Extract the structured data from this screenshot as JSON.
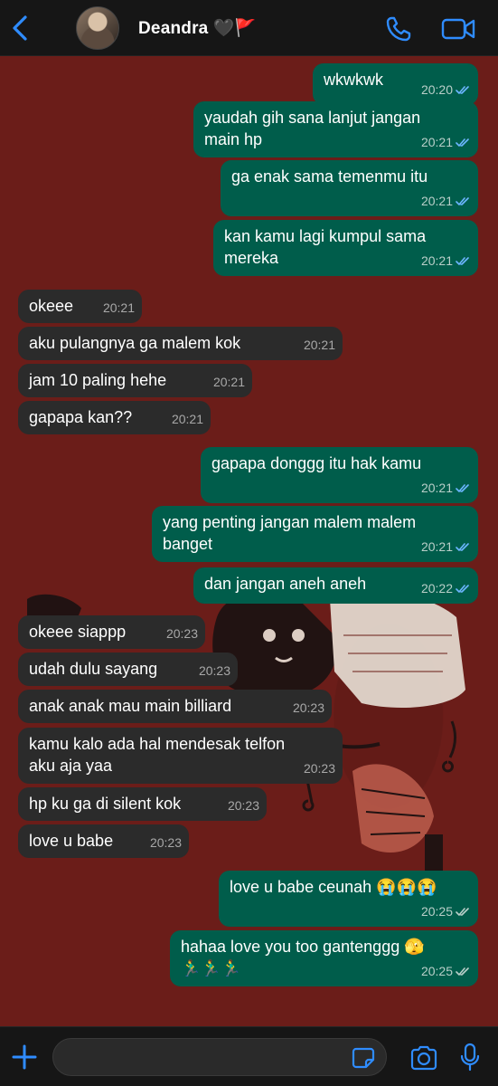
{
  "header": {
    "contact_name": "Deandra 🖤🚩",
    "back_icon": "chevron-left-icon",
    "call_icon": "phone-icon",
    "video_icon": "video-camera-icon"
  },
  "colors": {
    "outgoing_bubble": "#005d4b",
    "incoming_bubble": "#2b2b2b",
    "accent": "#2f8cff",
    "wallpaper": "#6b1d19"
  },
  "messages": [
    {
      "dir": "out",
      "text": "wkwkwk",
      "time": "20:20"
    },
    {
      "dir": "out",
      "text": "yaudah gih sana lanjut jangan\nmain hp",
      "time": "20:21"
    },
    {
      "dir": "out",
      "text": "ga enak sama temenmu itu",
      "time": "20:21"
    },
    {
      "dir": "out",
      "text": "kan kamu lagi kumpul sama\nmereka",
      "time": "20:21"
    },
    {
      "dir": "in",
      "text": "okeee",
      "time": "20:21"
    },
    {
      "dir": "in",
      "text": "aku pulangnya ga malem kok",
      "time": "20:21"
    },
    {
      "dir": "in",
      "text": "jam 10 paling hehe",
      "time": "20:21"
    },
    {
      "dir": "in",
      "text": "gapapa kan??",
      "time": "20:21"
    },
    {
      "dir": "out",
      "text": "gapapa donggg itu hak kamu",
      "time": "20:21"
    },
    {
      "dir": "out",
      "text": "yang penting jangan malem malem\nbanget",
      "time": "20:21"
    },
    {
      "dir": "out",
      "text": "dan jangan aneh aneh",
      "time": "20:22"
    },
    {
      "dir": "in",
      "text": "okeee siappp",
      "time": "20:23"
    },
    {
      "dir": "in",
      "text": "udah dulu sayang",
      "time": "20:23"
    },
    {
      "dir": "in",
      "text": "anak anak mau main billiard",
      "time": "20:23"
    },
    {
      "dir": "in",
      "text": "kamu kalo ada hal mendesak telfon\naku aja yaa",
      "time": "20:23"
    },
    {
      "dir": "in",
      "text": "hp ku ga di silent kok",
      "time": "20:23"
    },
    {
      "dir": "in",
      "text": "love u babe",
      "time": "20:23"
    },
    {
      "dir": "out",
      "text": "love u babe ceunah 😭😭😭",
      "time": "20:25"
    },
    {
      "dir": "out",
      "text": "hahaa love you too gantenggg 🫣\n🏃‍♂️🏃‍♂️🏃‍♂️",
      "time": "20:25"
    }
  ],
  "composer": {
    "placeholder": "",
    "value": "",
    "plus_icon": "plus-icon",
    "sticker_icon": "sticker-icon",
    "camera_icon": "camera-icon",
    "mic_icon": "microphone-icon"
  }
}
